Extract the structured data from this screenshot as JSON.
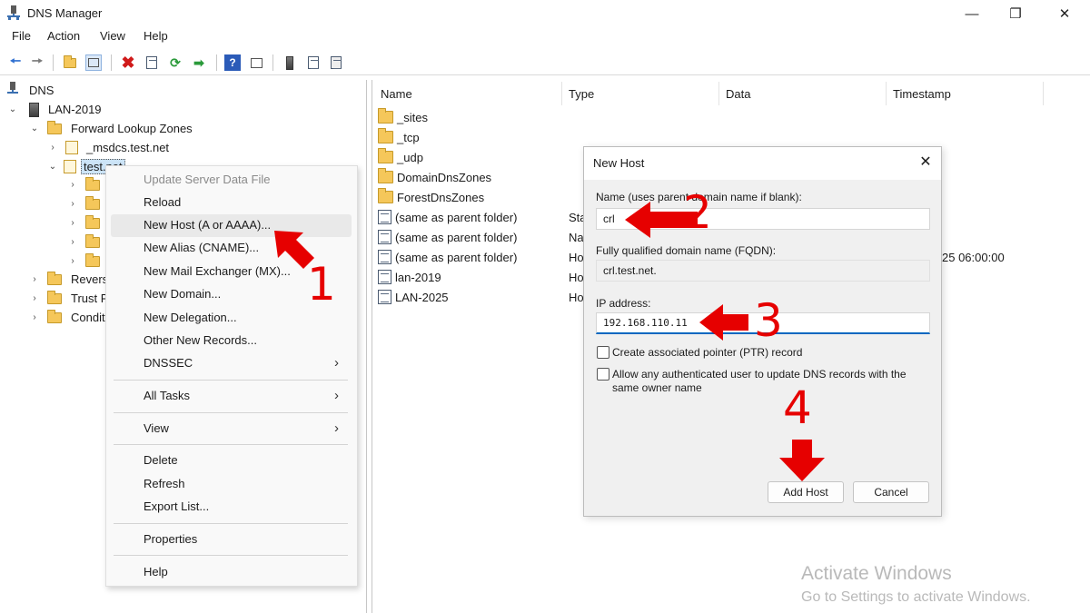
{
  "window": {
    "title": "DNS Manager"
  },
  "menu": [
    "File",
    "Action",
    "View",
    "Help"
  ],
  "tree": {
    "root": "DNS",
    "server": "LAN-2019",
    "forward_zones": "Forward Lookup Zones",
    "msdcs": "_msdcs.test.net",
    "testnet": "test.net",
    "reverse": "Revers",
    "trust": "Trust P",
    "conditional": "Condit"
  },
  "list": {
    "columns": [
      "Name",
      "Type",
      "Data",
      "Timestamp"
    ],
    "rows": [
      {
        "name": "_sites",
        "type": "",
        "icon": "folder"
      },
      {
        "name": "_tcp",
        "type": "",
        "icon": "folder"
      },
      {
        "name": "_udp",
        "type": "",
        "icon": "folder"
      },
      {
        "name": "DomainDnsZones",
        "type": "",
        "icon": "folder"
      },
      {
        "name": "ForestDnsZones",
        "type": "",
        "icon": "folder"
      },
      {
        "name": "(same as parent folder)",
        "type": "Sta",
        "icon": "record"
      },
      {
        "name": "(same as parent folder)",
        "type": "Na",
        "icon": "record"
      },
      {
        "name": "(same as parent folder)",
        "type": "Ho",
        "icon": "record"
      },
      {
        "name": "lan-2019",
        "type": "Ho",
        "icon": "record"
      },
      {
        "name": "LAN-2025",
        "type": "Ho",
        "icon": "record"
      }
    ],
    "timestamp_fragment": "25 06:00:00"
  },
  "context_menu": {
    "items": [
      "Update Server Data File",
      "Reload",
      "New Host (A or AAAA)...",
      "New Alias (CNAME)...",
      "New Mail Exchanger (MX)...",
      "New Domain...",
      "New Delegation...",
      "Other New Records...",
      "DNSSEC",
      "All Tasks",
      "View",
      "Delete",
      "Refresh",
      "Export List...",
      "Properties",
      "Help"
    ]
  },
  "dialog": {
    "title": "New Host",
    "name_label": "Name (uses parent domain name if blank):",
    "name_value": "crl",
    "fqdn_label": "Fully qualified domain name (FQDN):",
    "fqdn_value": "crl.test.net.",
    "ip_label": "IP address:",
    "ip_value": "192.168.110.11",
    "ptr_label": "Create associated pointer (PTR) record",
    "allow_label_1": "Allow any authenticated user to update DNS records with the",
    "allow_label_2": "same owner name",
    "add_button": "Add Host",
    "cancel_button": "Cancel"
  },
  "annotations": {
    "step1": "1",
    "step2": "2",
    "step3": "3",
    "step4": "4",
    "arrow_color": "#e60000"
  },
  "watermark": {
    "line1": "Activate Windows",
    "line2": "Go to Settings to activate Windows."
  }
}
